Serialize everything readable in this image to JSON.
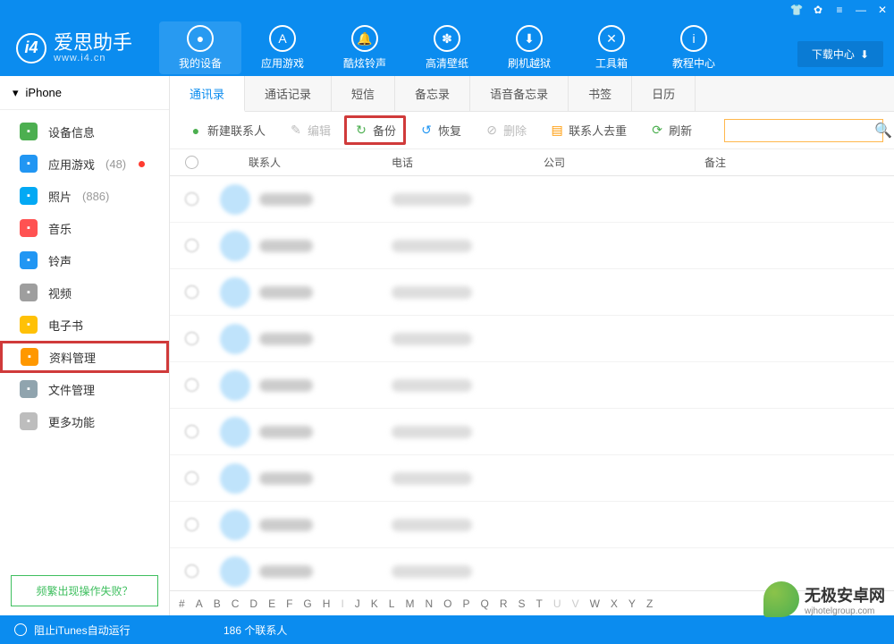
{
  "app": {
    "name": "爱思助手",
    "sub": "www.i4.cn"
  },
  "download_center": "下载中心",
  "topnav": [
    {
      "label": "我的设备",
      "icon": "apple"
    },
    {
      "label": "应用游戏",
      "icon": "A"
    },
    {
      "label": "酷炫铃声",
      "icon": "bell"
    },
    {
      "label": "高清壁纸",
      "icon": "flower"
    },
    {
      "label": "刷机越狱",
      "icon": "box"
    },
    {
      "label": "工具箱",
      "icon": "wrench"
    },
    {
      "label": "教程中心",
      "icon": "i"
    }
  ],
  "device": "iPhone",
  "sidebar": [
    {
      "label": "设备信息",
      "color": "#4caf50"
    },
    {
      "label": "应用游戏",
      "count": "(48)",
      "dot": true,
      "color": "#2196f3"
    },
    {
      "label": "照片",
      "count": "(886)",
      "color": "#03a9f4"
    },
    {
      "label": "音乐",
      "color": "#ff5252"
    },
    {
      "label": "铃声",
      "color": "#2196f3"
    },
    {
      "label": "视频",
      "color": "#9e9e9e"
    },
    {
      "label": "电子书",
      "color": "#ffc107"
    },
    {
      "label": "资料管理",
      "color": "#ff9800",
      "highlighted": true
    },
    {
      "label": "文件管理",
      "color": "#90a4ae"
    },
    {
      "label": "更多功能",
      "color": "#bdbdbd"
    }
  ],
  "help": "频繁出现操作失败？",
  "subtabs": [
    "通讯录",
    "通话记录",
    "短信",
    "备忘录",
    "语音备忘录",
    "书签",
    "日历"
  ],
  "active_subtab": 0,
  "toolbar": {
    "new": "新建联系人",
    "edit": "编辑",
    "backup": "备份",
    "restore": "恢复",
    "delete": "删除",
    "dedup": "联系人去重",
    "refresh": "刷新"
  },
  "columns": {
    "contact": "联系人",
    "phone": "电话",
    "company": "公司",
    "note": "备注"
  },
  "alpha": [
    "#",
    "A",
    "B",
    "C",
    "D",
    "E",
    "F",
    "G",
    "H",
    "I",
    "J",
    "K",
    "L",
    "M",
    "N",
    "O",
    "P",
    "Q",
    "R",
    "S",
    "T",
    "U",
    "V",
    "W",
    "X",
    "Y",
    "Z"
  ],
  "alpha_dim": [
    "I",
    "U",
    "V"
  ],
  "status": {
    "left": "阻止iTunes自动运行",
    "count": "186 个联系人"
  },
  "watermark": {
    "name": "无极安卓网",
    "url": "wjhotelgroup.com"
  },
  "rows_count": 9
}
